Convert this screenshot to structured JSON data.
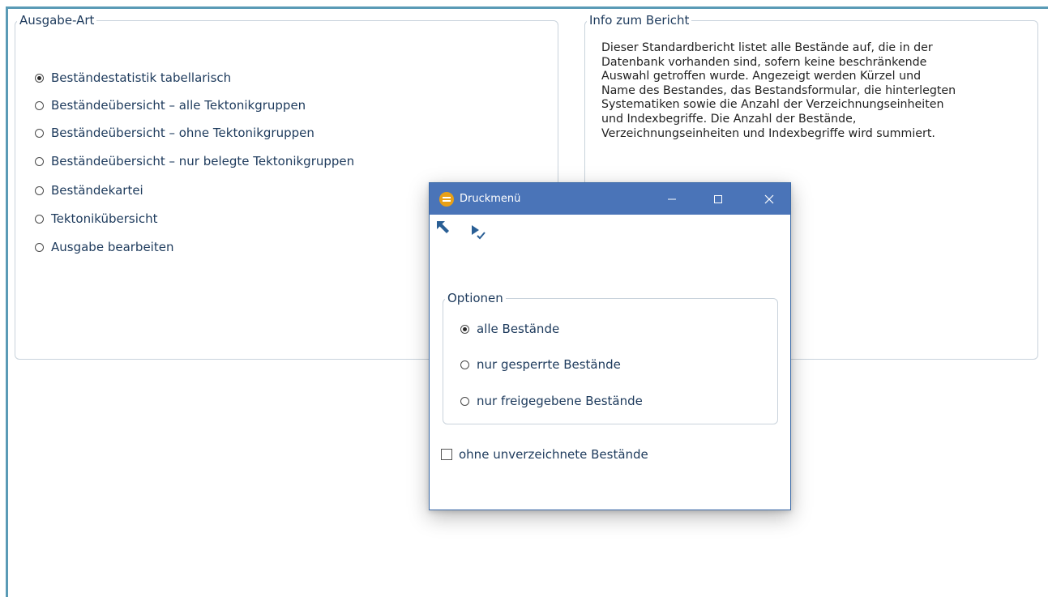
{
  "left_group": {
    "legend": "Ausgabe-Art",
    "options": [
      {
        "label": "Beständestatistik tabellarisch",
        "checked": true
      },
      {
        "label": "Beständeübersicht – alle Tektonikgruppen",
        "checked": false
      },
      {
        "label": "Beständeübersicht – ohne Tektonikgruppen",
        "checked": false
      },
      {
        "label": "Beständeübersicht – nur belegte Tektonikgruppen",
        "checked": false
      },
      {
        "label": "Beständekartei",
        "checked": false
      },
      {
        "label": "Tektonikübersicht",
        "checked": false
      },
      {
        "label": "Ausgabe bearbeiten",
        "checked": false
      }
    ]
  },
  "right_group": {
    "legend": "Info zum Bericht",
    "text_lines": [
      "Dieser Standardbericht listet alle Bestände auf, die in der",
      "Datenbank vorhanden sind, sofern keine beschränkende",
      "Auswahl getroffen wurde. Angezeigt werden Kürzel und",
      "Name des Bestandes, das Bestandsformular, die hinterlegten",
      "Systematiken sowie die Anzahl der Verzeichnungseinheiten",
      "und Indexbegriffe. Die Anzahl der Bestände,",
      "Verzeichnungseinheiten und Indexbegriffe wird summiert."
    ]
  },
  "dialog": {
    "title": "Druckmenü",
    "toolbar": {
      "back_icon": "arrow-up-left-icon",
      "run_icon": "play-check-icon"
    },
    "options_group": {
      "legend": "Optionen",
      "options": [
        {
          "label": "alle Bestände",
          "checked": true
        },
        {
          "label": "nur gesperrte Bestände",
          "checked": false
        },
        {
          "label": "nur freigegebene Bestände",
          "checked": false
        }
      ]
    },
    "checkbox": {
      "label": "ohne unverzeichnete Bestände",
      "checked": false
    }
  },
  "colors": {
    "frame": "#5a9bb6",
    "titlebar": "#4a74b8",
    "text": "#1d3a5c",
    "app_icon": "#e8a018",
    "border": "#c9d3dc"
  }
}
